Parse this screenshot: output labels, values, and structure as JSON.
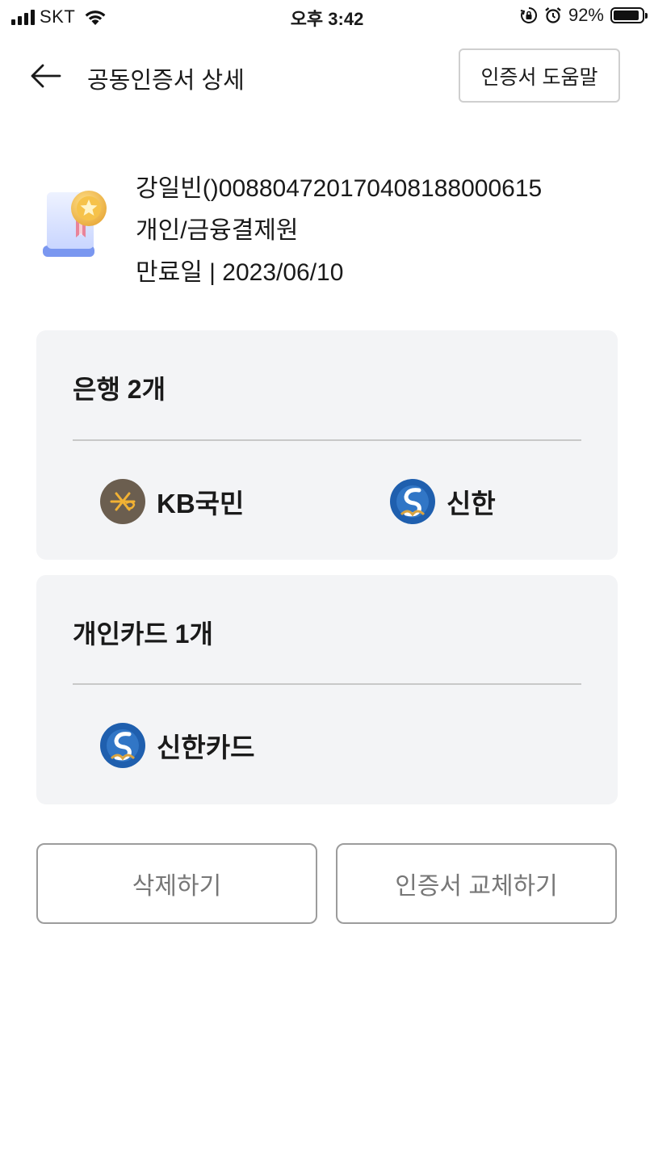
{
  "status_bar": {
    "carrier": "SKT",
    "time": "오후 3:42",
    "battery_percent": "92%",
    "battery_level": 0.92
  },
  "header": {
    "title": "공동인증서 상세",
    "help_button": "인증서 도움말"
  },
  "certificate": {
    "name": "강일빈()0088047201704081880006​15",
    "type": "개인/금융결제원",
    "expiry": "만료일 | 2023/06/10"
  },
  "banks": {
    "title": "은행 2개",
    "items": [
      {
        "name": "KB국민",
        "icon": "kb-logo-icon",
        "color": "#6b5e4f"
      },
      {
        "name": "신한",
        "icon": "shinhan-logo-icon",
        "color": "#1f5fae"
      }
    ]
  },
  "cards": {
    "title": "개인카드 1개",
    "items": [
      {
        "name": "신한카드",
        "icon": "shinhan-logo-icon",
        "color": "#1f5fae"
      }
    ]
  },
  "actions": {
    "delete": "삭제하기",
    "replace": "인증서 교체하기"
  }
}
